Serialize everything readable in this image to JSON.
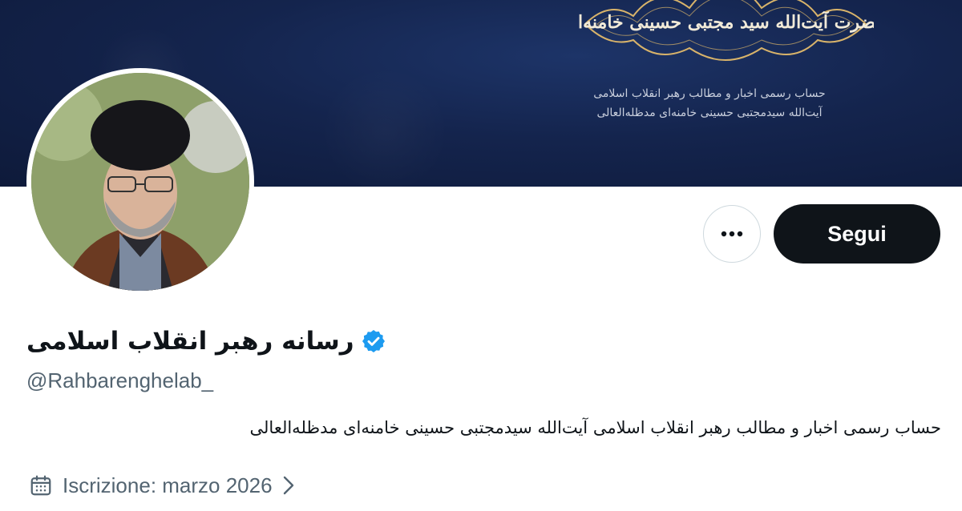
{
  "banner": {
    "emblem_text": "حضرت آیت‌الله سید مجتبی حسینی خامنه‌ای",
    "line1": "حساب رسمی اخبار و مطالب رهبر انقلاب اسلامی",
    "line2": "آیت‌الله سیدمجتبی حسینی خامنه‌ای مدظله‌العالی"
  },
  "profile": {
    "display_name": "رسانه رهبر انقلاب اسلامی",
    "verified": true,
    "handle": "@Rahbarenghelab_",
    "bio": "حساب رسمی اخبار و مطالب رهبر انقلاب اسلامی آیت‌الله سیدمجتبی حسینی خامنه‌ای مدظله‌العالی",
    "joined": "Iscrizione: marzo 2026"
  },
  "actions": {
    "follow_label": "Segui",
    "more_icon": "more-horizontal-icon"
  },
  "colors": {
    "banner_dark": "#0e1a3a",
    "banner_mid": "#1d3468",
    "gold": "#d8b36a",
    "verified_blue": "#1d9bf0",
    "follow_bg": "#0f1419",
    "secondary_text": "#536471"
  }
}
